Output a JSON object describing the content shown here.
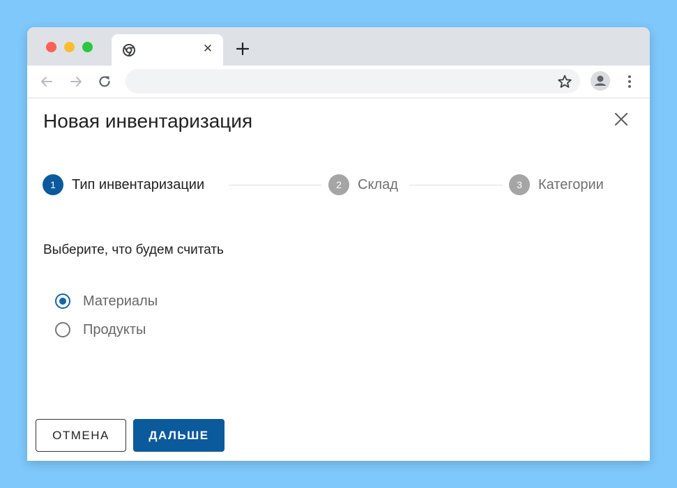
{
  "browser": {
    "traffic_lights": {
      "close": "#ff5f57",
      "minimize": "#febc2e",
      "maximize": "#28c840"
    },
    "tab": {
      "favicon": "chrome-icon",
      "close_glyph": "✕"
    },
    "icons": {
      "new_tab": "plus-icon",
      "back": "arrow-left-icon",
      "forward": "arrow-right-icon",
      "reload": "reload-icon",
      "bookmark": "star-icon",
      "profile": "person-icon",
      "menu": "kebab-menu-icon"
    },
    "address": {
      "value": ""
    }
  },
  "dialog": {
    "title": "Новая инвентаризация",
    "close_icon": "close-icon",
    "steps": [
      {
        "number": "1",
        "label": "Тип инвентаризации",
        "active": true
      },
      {
        "number": "2",
        "label": "Склад",
        "active": false
      },
      {
        "number": "3",
        "label": "Категории",
        "active": false
      }
    ],
    "prompt": "Выберите, что будем считать",
    "options": [
      {
        "label": "Материалы",
        "selected": true
      },
      {
        "label": "Продукты",
        "selected": false
      }
    ],
    "buttons": {
      "cancel": "ОТМЕНА",
      "next": "ДАЛЬШЕ"
    }
  },
  "colors": {
    "accent": "#0b5a9c",
    "step_inactive": "#a5a5a5",
    "background": "#7ec8fc"
  }
}
